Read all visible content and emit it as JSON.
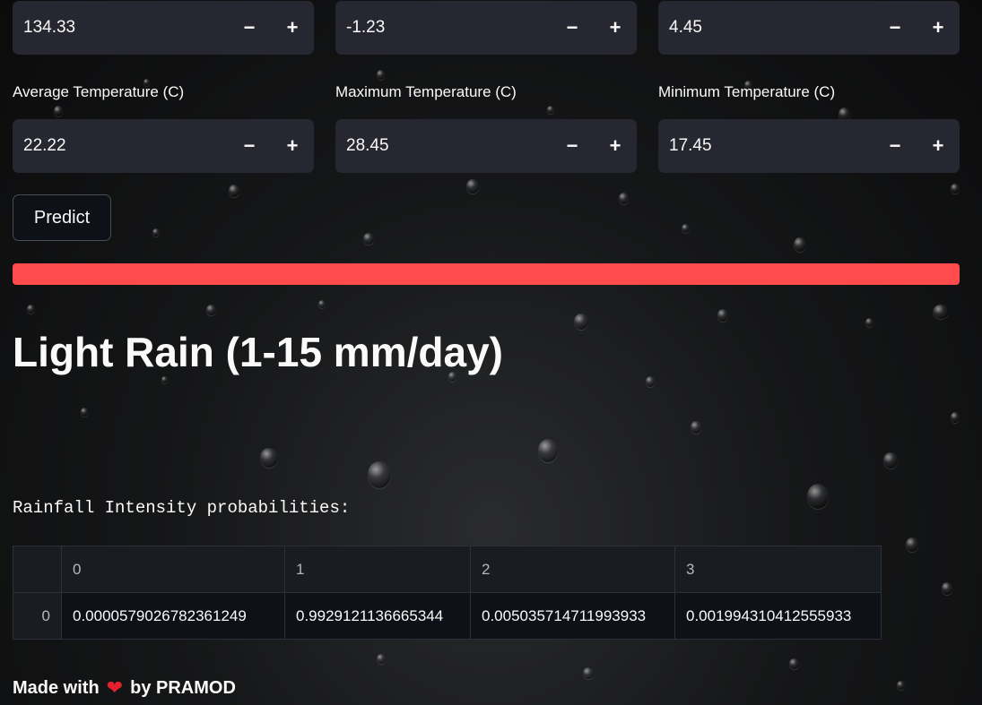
{
  "inputs_row1": [
    {
      "value": "134.33"
    },
    {
      "value": "-1.23"
    },
    {
      "value": "4.45"
    }
  ],
  "inputs_row2": [
    {
      "label": "Average Temperature (C)",
      "value": "22.22"
    },
    {
      "label": "Maximum Temperature (C)",
      "value": "28.45"
    },
    {
      "label": "Minimum Temperature (C)",
      "value": "17.45"
    }
  ],
  "stepper": {
    "minus": "−",
    "plus": "+"
  },
  "predict_button": "Predict",
  "progress": {
    "percent": 100,
    "color": "#ff4b4b"
  },
  "result": "Light Rain (1-15 mm/day)",
  "probabilities_label": "Rainfall Intensity probabilities:",
  "table": {
    "columns": [
      "",
      "0",
      "1",
      "2",
      "3"
    ],
    "rows": [
      [
        "0",
        "0.0000579026782361249",
        "0.9929121136665344",
        "0.005035714711993933",
        "0.001994310412555933"
      ]
    ]
  },
  "footer": {
    "made_with": "Made with",
    "heart_icon": "heart-icon",
    "by": "by PRAMOD"
  }
}
